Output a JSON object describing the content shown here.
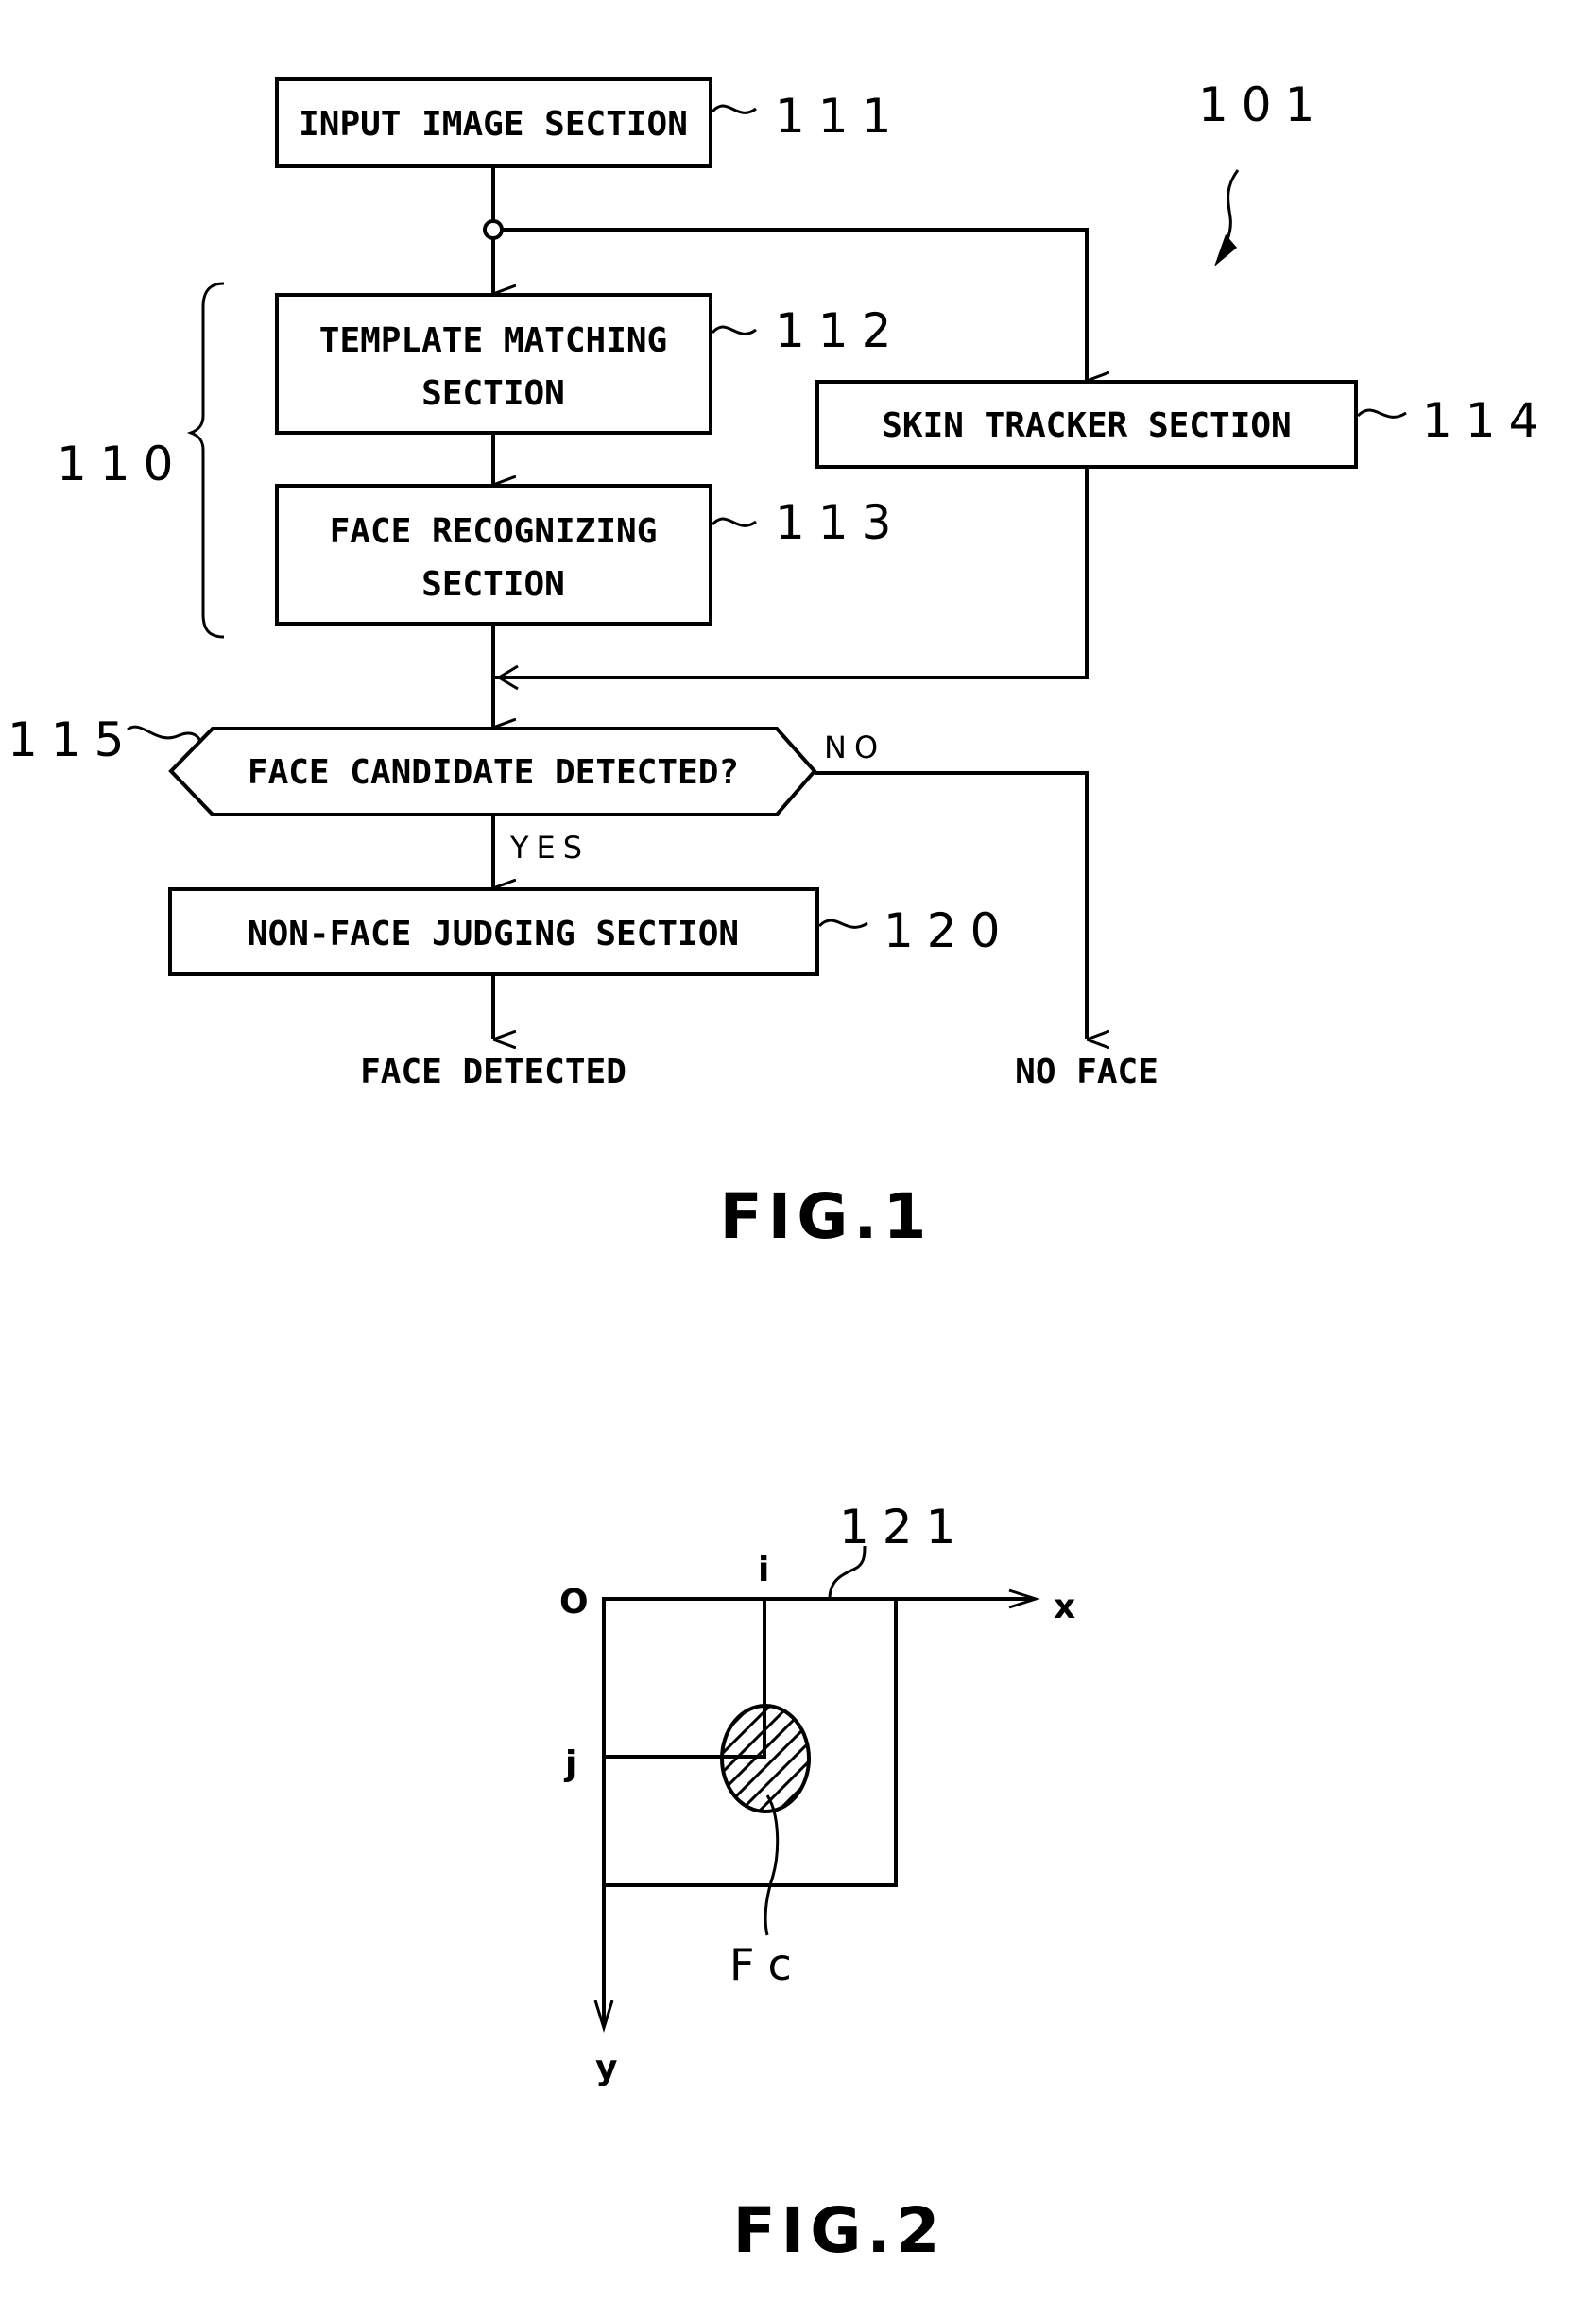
{
  "figure1": {
    "caption": "FIG.1",
    "system_ref": "101",
    "group_ref": "110",
    "blocks": {
      "input": {
        "label": "INPUT IMAGE SECTION",
        "ref": "111"
      },
      "template": {
        "line1": "TEMPLATE MATCHING",
        "line2": "SECTION",
        "ref": "112"
      },
      "face_rec": {
        "line1": "FACE RECOGNIZING",
        "line2": "SECTION",
        "ref": "113"
      },
      "skin": {
        "label": "SKIN TRACKER SECTION",
        "ref": "114"
      },
      "decision": {
        "label": "FACE CANDIDATE DETECTED?",
        "ref": "115"
      },
      "non_face": {
        "label": "NON-FACE JUDGING SECTION",
        "ref": "120"
      }
    },
    "branches": {
      "yes": "YES",
      "no": "NO"
    },
    "outputs": {
      "face": "FACE DETECTED",
      "no_face": "NO FACE"
    }
  },
  "figure2": {
    "caption": "FIG.2",
    "image_ref": "121",
    "origin": "O",
    "x_axis": "x",
    "y_axis": "y",
    "i_label": "i",
    "j_label": "j",
    "face_label": "Fc"
  }
}
